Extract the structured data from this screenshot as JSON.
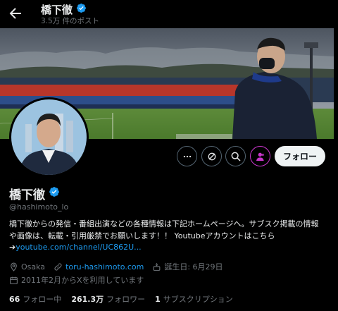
{
  "header": {
    "title": "橋下徹",
    "post_count": "3.5万 件のポスト"
  },
  "profile": {
    "name": "橋下徹",
    "handle": "@hashimoto_lo",
    "bio_line1": "橋下徹からの発信・番組出演などの各種情報は下記ホームページへ。サブスク掲載の情報",
    "bio_line2": "や画像は、転載・引用厳禁でお願いします！！ Youtubeアカウントはこちら",
    "bio_arrow": "➔",
    "bio_link": "youtube.com/channel/UC862U...",
    "location": "Osaka",
    "website": "toru-hashimoto.com",
    "birthday": "誕生日: 6月29日",
    "joined": "2011年2月からXを利用しています",
    "following_count": "66",
    "following_label": "フォロー中",
    "followers_count": "261.3万",
    "followers_label": "フォロワー",
    "subs_count": "1",
    "subs_label": "サブスクリプション"
  },
  "actions": {
    "follow_label": "フォロー"
  },
  "colors": {
    "accent": "#1d9bf0",
    "subscribe": "#c936cc",
    "muted": "#71767b",
    "background": "#000000"
  },
  "icons": [
    "back-arrow-icon",
    "verified-badge-icon",
    "more-icon",
    "grok-icon",
    "search-icon",
    "subscribe-icon",
    "location-icon",
    "link-icon",
    "birthday-icon",
    "calendar-icon"
  ]
}
